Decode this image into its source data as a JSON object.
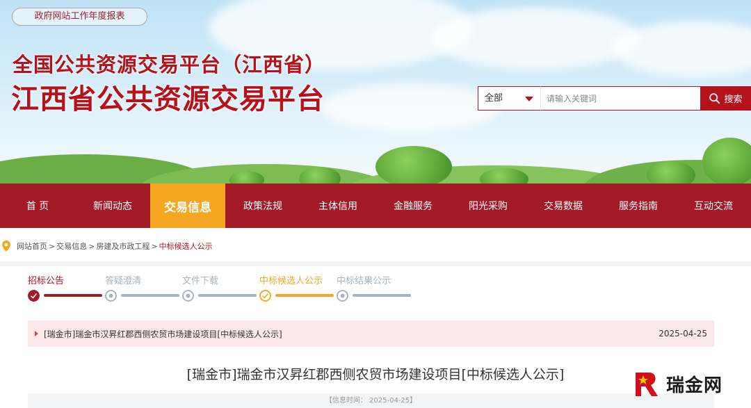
{
  "header": {
    "annual_report_link": "政府网站工作年度报表",
    "subtitle": "全国公共资源交易平台（江西省）",
    "title": "江西省公共资源交易平台"
  },
  "search": {
    "category": "全部",
    "placeholder": "请输入关键词",
    "button_label": "搜索"
  },
  "nav": {
    "items": [
      "首 页",
      "新闻动态",
      "交易信息",
      "政策法规",
      "主体信用",
      "金融服务",
      "阳光采购",
      "交易数据",
      "服务指南",
      "互动交流"
    ],
    "active_index": 2
  },
  "breadcrumb": {
    "items": [
      "网站首页",
      "交易信息",
      "房建及市政工程",
      "中标候选人公示"
    ],
    "separator": ">"
  },
  "steps": {
    "items": [
      {
        "label": "招标公告",
        "state": "done"
      },
      {
        "label": "答疑澄清",
        "state": "inactive"
      },
      {
        "label": "文件下载",
        "state": "inactive"
      },
      {
        "label": "中标候选人公示",
        "state": "current"
      },
      {
        "label": "中标结果公示",
        "state": "inactive"
      }
    ]
  },
  "notice": {
    "title": "[瑞金市]瑞金市汉昇红郡西侧农贸市场建设项目[中标候选人公示]",
    "date": "2025-04-25"
  },
  "article": {
    "title": "[瑞金市]瑞金市汉昇红郡西侧农贸市场建设项目[中标候选人公示]",
    "info": "【信息时间：   2025-04-25】"
  },
  "watermark": {
    "text": "瑞金网"
  },
  "colors": {
    "brand_red": "#b5121b",
    "nav_bg": "#a11a26",
    "active_orange": "#f5a623",
    "inactive_gray": "#a9b3bd",
    "notice_bg": "#fbe9ea"
  }
}
